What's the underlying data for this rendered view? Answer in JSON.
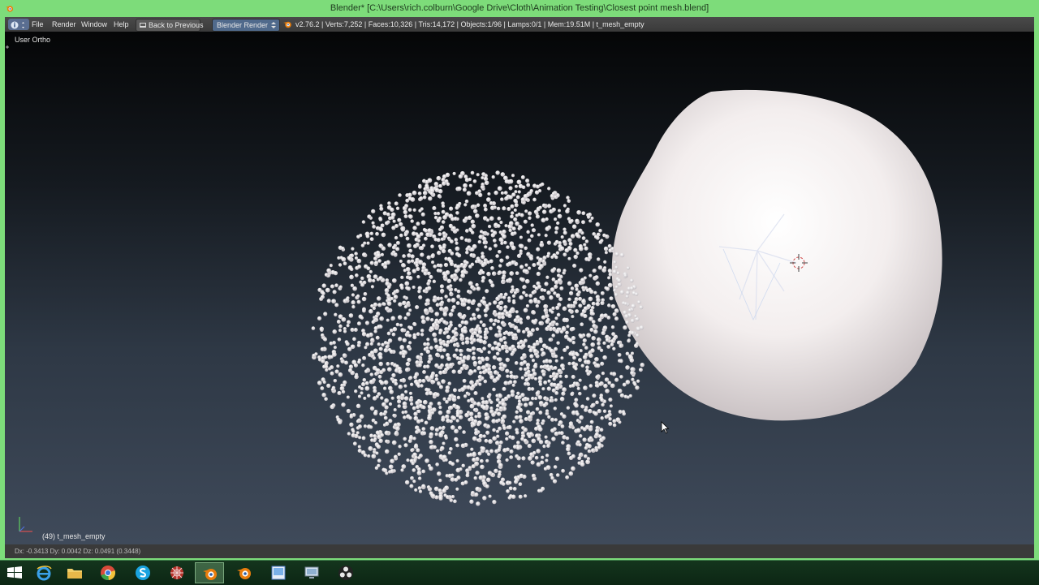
{
  "window": {
    "title": "Blender* [C:\\Users\\rich.colburn\\Google Drive\\Cloth\\Animation Testing\\Closest point mesh.blend]"
  },
  "header": {
    "menus": [
      "File",
      "Render",
      "Window",
      "Help"
    ],
    "back_label": "Back to Previous",
    "render_engine": "Blender Render",
    "stats": "v2.76.2 | Verts:7,252 | Faces:10,326 | Tris:14,172 | Objects:1/96 | Lamps:0/1 | Mem:19.51M | t_mesh_empty"
  },
  "viewport": {
    "view_label": "User Ortho",
    "object_label": "(49) t_mesh_empty"
  },
  "statusbar": {
    "text": "Dx: -0.3413   Dy: 0.0042   Dz: 0.0491 (0.3448)"
  },
  "taskbar": {
    "items": [
      "windows-start",
      "internet-explorer",
      "file-explorer",
      "chrome",
      "skype",
      "network-app",
      "blender",
      "blender",
      "image-viewer",
      "remote-desktop",
      "obs"
    ],
    "active_index": 6
  }
}
